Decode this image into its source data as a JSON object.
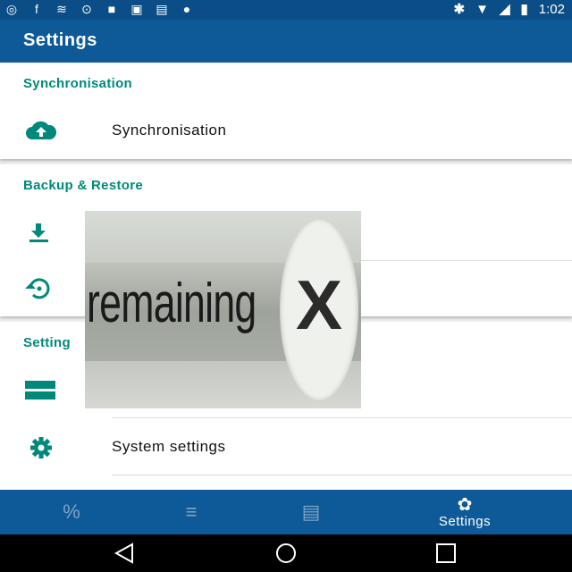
{
  "status_bar": {
    "time": "1:02",
    "left_icons": [
      "ring-icon",
      "facebook-icon",
      "wave-icon",
      "alarm-icon",
      "lock-icon",
      "photo-icon",
      "briefcase-icon",
      "android-icon"
    ],
    "right_icons": [
      "bluetooth-icon",
      "wifi-icon",
      "signal-icon",
      "battery-icon"
    ]
  },
  "app_bar": {
    "title": "Settings"
  },
  "sections": [
    {
      "header": "Synchronisation",
      "items": [
        {
          "label": "Synchronisation",
          "icon": "cloud-upload-icon"
        }
      ]
    },
    {
      "header": "Backup & Restore",
      "items": [
        {
          "label": "",
          "icon": "download-icon"
        },
        {
          "label": "",
          "icon": "restore-icon"
        }
      ]
    },
    {
      "header": "Setting",
      "items": [
        {
          "label": "",
          "icon": "storage-icon"
        },
        {
          "label": "System settings",
          "icon": "gear-icon"
        }
      ]
    }
  ],
  "ad_overlay": {
    "text": "remaining",
    "close_glyph": "X"
  },
  "bottom_nav": {
    "items": [
      {
        "icon": "percent-icon",
        "label": ""
      },
      {
        "icon": "list-icon",
        "label": ""
      },
      {
        "icon": "server-icon",
        "label": ""
      },
      {
        "icon": "gear-icon",
        "label": "Settings",
        "active": true
      }
    ]
  },
  "system_nav": [
    "back-icon",
    "home-icon",
    "recents-icon"
  ],
  "colors": {
    "primary": "#0e5a98",
    "status_bar": "#0b4d86",
    "accent": "#00897b",
    "background": "#f0f0f0"
  }
}
